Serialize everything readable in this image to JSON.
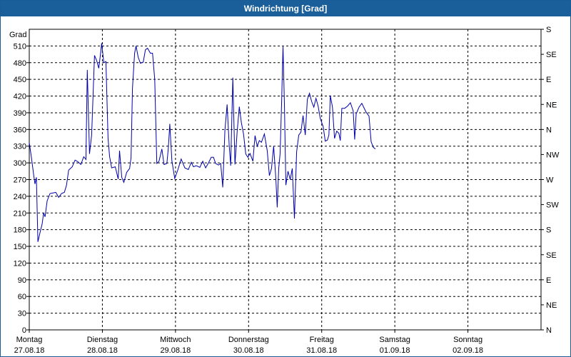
{
  "window": {
    "title": "Windrichtung [Grad]"
  },
  "chart_data": {
    "type": "line",
    "title": "Windrichtung [Grad]",
    "ylabel": "Grad",
    "ylim": [
      0,
      540
    ],
    "yticks": [
      0,
      30,
      60,
      90,
      120,
      150,
      180,
      210,
      240,
      270,
      300,
      330,
      360,
      390,
      420,
      450,
      480,
      510
    ],
    "right_axis": {
      "ylim": [
        0,
        540
      ],
      "ticks": [
        {
          "value": 0,
          "label": "N"
        },
        {
          "value": 45,
          "label": "NE"
        },
        {
          "value": 90,
          "label": "E"
        },
        {
          "value": 135,
          "label": "SE"
        },
        {
          "value": 180,
          "label": "S"
        },
        {
          "value": 225,
          "label": "SW"
        },
        {
          "value": 270,
          "label": "W"
        },
        {
          "value": 315,
          "label": "NW"
        },
        {
          "value": 360,
          "label": "N"
        },
        {
          "value": 405,
          "label": "NE"
        },
        {
          "value": 450,
          "label": "E"
        },
        {
          "value": 495,
          "label": "SE"
        },
        {
          "value": 540,
          "label": "S"
        }
      ]
    },
    "xlim": [
      0,
      7
    ],
    "xticks": [
      {
        "value": 0,
        "day": "Montag",
        "date": "27.08.18"
      },
      {
        "value": 1,
        "day": "Dienstag",
        "date": "28.08.18"
      },
      {
        "value": 2,
        "day": "Mittwoch",
        "date": "29.08.18"
      },
      {
        "value": 3,
        "day": "Donnerstag",
        "date": "30.08.18"
      },
      {
        "value": 4,
        "day": "Freitag",
        "date": "31.08.18"
      },
      {
        "value": 5,
        "day": "Samstag",
        "date": "01.09.18"
      },
      {
        "value": 6,
        "day": "Sonntag",
        "date": "02.09.18"
      }
    ],
    "grid": true,
    "color": "#0000aa",
    "series": [
      {
        "name": "",
        "points": [
          [
            0.0,
            336
          ],
          [
            0.029,
            310
          ],
          [
            0.059,
            280
          ],
          [
            0.078,
            262
          ],
          [
            0.098,
            274
          ],
          [
            0.118,
            158
          ],
          [
            0.147,
            175
          ],
          [
            0.176,
            190
          ],
          [
            0.196,
            210
          ],
          [
            0.216,
            203
          ],
          [
            0.245,
            232
          ],
          [
            0.284,
            245
          ],
          [
            0.323,
            246
          ],
          [
            0.363,
            247
          ],
          [
            0.402,
            238
          ],
          [
            0.441,
            245
          ],
          [
            0.48,
            247
          ],
          [
            0.51,
            260
          ],
          [
            0.539,
            287
          ],
          [
            0.588,
            293
          ],
          [
            0.627,
            305
          ],
          [
            0.667,
            302
          ],
          [
            0.706,
            297
          ],
          [
            0.745,
            311
          ],
          [
            0.775,
            306
          ],
          [
            0.794,
            467
          ],
          [
            0.824,
            316
          ],
          [
            0.853,
            350
          ],
          [
            0.892,
            493
          ],
          [
            0.922,
            484
          ],
          [
            0.951,
            470
          ],
          [
            0.98,
            502
          ],
          [
            0.99,
            515
          ],
          [
            1.02,
            480
          ],
          [
            1.049,
            482
          ],
          [
            1.078,
            344
          ],
          [
            1.098,
            312
          ],
          [
            1.127,
            291
          ],
          [
            1.176,
            293
          ],
          [
            1.216,
            271
          ],
          [
            1.235,
            322
          ],
          [
            1.265,
            274
          ],
          [
            1.294,
            265
          ],
          [
            1.333,
            283
          ],
          [
            1.373,
            290
          ],
          [
            1.392,
            309
          ],
          [
            1.412,
            434
          ],
          [
            1.441,
            497
          ],
          [
            1.461,
            510
          ],
          [
            1.49,
            490
          ],
          [
            1.52,
            479
          ],
          [
            1.559,
            481
          ],
          [
            1.588,
            503
          ],
          [
            1.618,
            506
          ],
          [
            1.657,
            497
          ],
          [
            1.686,
            497
          ],
          [
            1.716,
            450
          ],
          [
            1.745,
            299
          ],
          [
            1.775,
            303
          ],
          [
            1.814,
            325
          ],
          [
            1.843,
            297
          ],
          [
            1.882,
            299
          ],
          [
            1.902,
            326
          ],
          [
            1.922,
            370
          ],
          [
            1.951,
            304
          ],
          [
            1.99,
            272
          ],
          [
            2.029,
            286
          ],
          [
            2.078,
            307
          ],
          [
            2.127,
            291
          ],
          [
            2.176,
            288
          ],
          [
            2.216,
            301
          ],
          [
            2.245,
            293
          ],
          [
            2.284,
            295
          ],
          [
            2.333,
            292
          ],
          [
            2.373,
            303
          ],
          [
            2.412,
            291
          ],
          [
            2.451,
            300
          ],
          [
            2.49,
            310
          ],
          [
            2.52,
            310
          ],
          [
            2.549,
            299
          ],
          [
            2.588,
            296
          ],
          [
            2.618,
            299
          ],
          [
            2.647,
            256
          ],
          [
            2.676,
            358
          ],
          [
            2.706,
            405
          ],
          [
            2.735,
            332
          ],
          [
            2.755,
            295
          ],
          [
            2.784,
            453
          ],
          [
            2.814,
            297
          ],
          [
            2.843,
            355
          ],
          [
            2.873,
            401
          ],
          [
            2.902,
            372
          ],
          [
            2.931,
            352
          ],
          [
            2.961,
            316
          ],
          [
            2.99,
            310
          ],
          [
            3.02,
            317
          ],
          [
            3.059,
            303
          ],
          [
            3.088,
            349
          ],
          [
            3.118,
            330
          ],
          [
            3.147,
            340
          ],
          [
            3.176,
            337
          ],
          [
            3.216,
            352
          ],
          [
            3.255,
            322
          ],
          [
            3.284,
            277
          ],
          [
            3.314,
            290
          ],
          [
            3.343,
            330
          ],
          [
            3.373,
            271
          ],
          [
            3.392,
            220
          ],
          [
            3.412,
            290
          ],
          [
            3.431,
            316
          ],
          [
            3.451,
            406
          ],
          [
            3.471,
            509
          ],
          [
            3.49,
            405
          ],
          [
            3.51,
            260
          ],
          [
            3.539,
            285
          ],
          [
            3.569,
            270
          ],
          [
            3.598,
            290
          ],
          [
            3.627,
            200
          ],
          [
            3.657,
            320
          ],
          [
            3.686,
            350
          ],
          [
            3.716,
            355
          ],
          [
            3.745,
            385
          ],
          [
            3.775,
            350
          ],
          [
            3.804,
            414
          ],
          [
            3.833,
            425
          ],
          [
            3.863,
            410
          ],
          [
            3.892,
            400
          ],
          [
            3.922,
            416
          ],
          [
            3.951,
            402
          ],
          [
            3.98,
            380
          ],
          [
            4.02,
            365
          ],
          [
            4.049,
            339
          ],
          [
            4.078,
            341
          ],
          [
            4.098,
            350
          ],
          [
            4.118,
            421
          ],
          [
            4.147,
            400
          ],
          [
            4.176,
            344
          ],
          [
            4.206,
            357
          ],
          [
            4.235,
            353
          ],
          [
            4.255,
            340
          ],
          [
            4.275,
            398
          ],
          [
            4.314,
            398
          ],
          [
            4.353,
            402
          ],
          [
            4.392,
            408
          ],
          [
            4.431,
            393
          ],
          [
            4.451,
            342
          ],
          [
            4.471,
            388
          ],
          [
            4.51,
            400
          ],
          [
            4.549,
            407
          ],
          [
            4.578,
            399
          ],
          [
            4.608,
            391
          ],
          [
            4.647,
            384
          ],
          [
            4.676,
            338
          ],
          [
            4.706,
            328
          ],
          [
            4.735,
            325
          ]
        ]
      }
    ]
  }
}
